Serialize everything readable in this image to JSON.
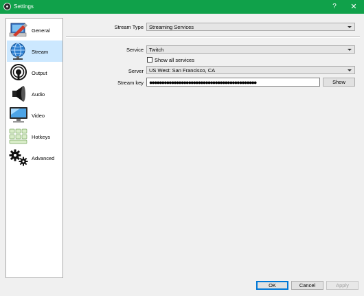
{
  "window": {
    "title": "Settings",
    "help_glyph": "?",
    "close_glyph": "✕"
  },
  "sidebar": {
    "items": [
      {
        "label": "General",
        "icon": "general-icon",
        "active": false
      },
      {
        "label": "Stream",
        "icon": "stream-icon",
        "active": true
      },
      {
        "label": "Output",
        "icon": "output-icon",
        "active": false
      },
      {
        "label": "Audio",
        "icon": "audio-icon",
        "active": false
      },
      {
        "label": "Video",
        "icon": "video-icon",
        "active": false
      },
      {
        "label": "Hotkeys",
        "icon": "hotkeys-icon",
        "active": false
      },
      {
        "label": "Advanced",
        "icon": "advanced-icon",
        "active": false
      }
    ]
  },
  "stream": {
    "stream_type_label": "Stream Type",
    "stream_type_value": "Streaming Services",
    "service_label": "Service",
    "service_value": "Twitch",
    "show_all_label": "Show all services",
    "show_all_checked": false,
    "server_label": "Server",
    "server_value": "US West: San Francisco, CA",
    "stream_key_label": "Stream key",
    "stream_key_mask": "●●●●●●●●●●●●●●●●●●●●●●●●●●●●●●●●●●●●●●●●●●●●",
    "show_button": "Show"
  },
  "footer": {
    "ok": "OK",
    "cancel": "Cancel",
    "apply": "Apply"
  },
  "colors": {
    "titlebar": "#10a14a",
    "selected_item": "#cce8ff",
    "focus_border": "#0078d7"
  }
}
